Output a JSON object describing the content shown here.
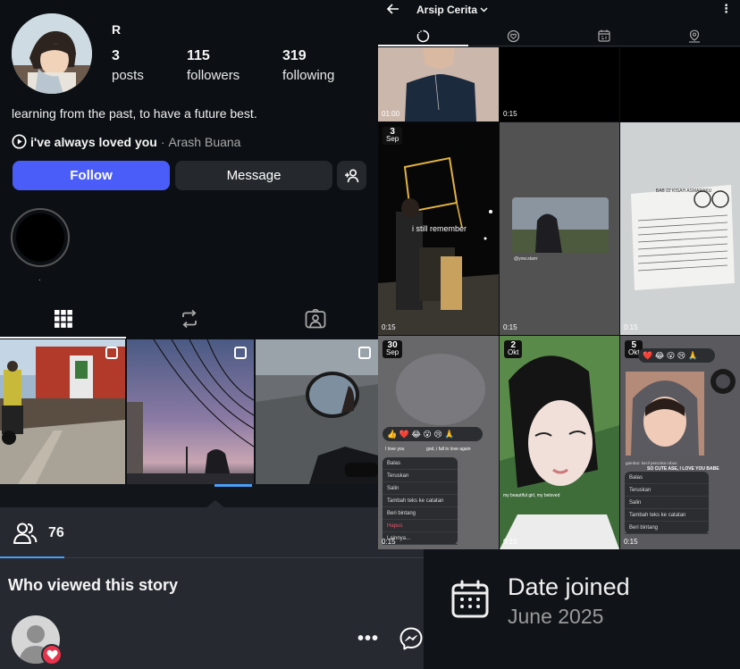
{
  "profile": {
    "username": "R",
    "stats": [
      {
        "num": "3",
        "label": "posts"
      },
      {
        "num": "115",
        "label": "followers"
      },
      {
        "num": "319",
        "label": "following"
      }
    ],
    "bio": "learning from the past, to have a future best.",
    "music": {
      "song": "i've always loved you",
      "separator": "·",
      "artist": "Arash Buana"
    },
    "follow_label": "Follow",
    "message_label": "Message",
    "highlight_label": "."
  },
  "viewers": {
    "count": "76",
    "title": "Who viewed this story"
  },
  "joined": {
    "label": "Date joined",
    "value": "June 2025"
  },
  "archive": {
    "title": "Arsip Cerita",
    "cells": [
      {
        "dur": "01:00"
      },
      {
        "dur": "0:15"
      },
      {
        "dur": ""
      },
      {
        "date_day": "3",
        "date_month": "Sep",
        "overlay": "i still remember",
        "dur": "0:15"
      },
      {
        "overlay": "@yow.starrr",
        "dur": "0:15"
      },
      {
        "overlay": "BAB 22  KISAH ASMARAKU",
        "dur": "0:15"
      },
      {
        "date_day": "30",
        "date_month": "Sep",
        "reply": "I love you",
        "caption": "god, i fall in love again",
        "dur": "0:15"
      },
      {
        "date_day": "2",
        "date_month": "Okt",
        "caption": "my beautiful girl, my beloved",
        "dur": "0:15"
      },
      {
        "date_day": "5",
        "date_month": "Okt",
        "caption": "SO CUTE ASE, I LOVE YOU BABE",
        "reply": "gambar: kecil pencinta robus",
        "dur": "0:15"
      }
    ],
    "menu": [
      "Balas",
      "Teruskan",
      "Salin",
      "Tambah teks ke catatan",
      "Beri bintang",
      "Hapus",
      "Lainnya..."
    ],
    "menu_short": [
      "Balas",
      "Teruskan",
      "Salin",
      "Tambah teks ke catatan",
      "Beri bintang"
    ]
  }
}
